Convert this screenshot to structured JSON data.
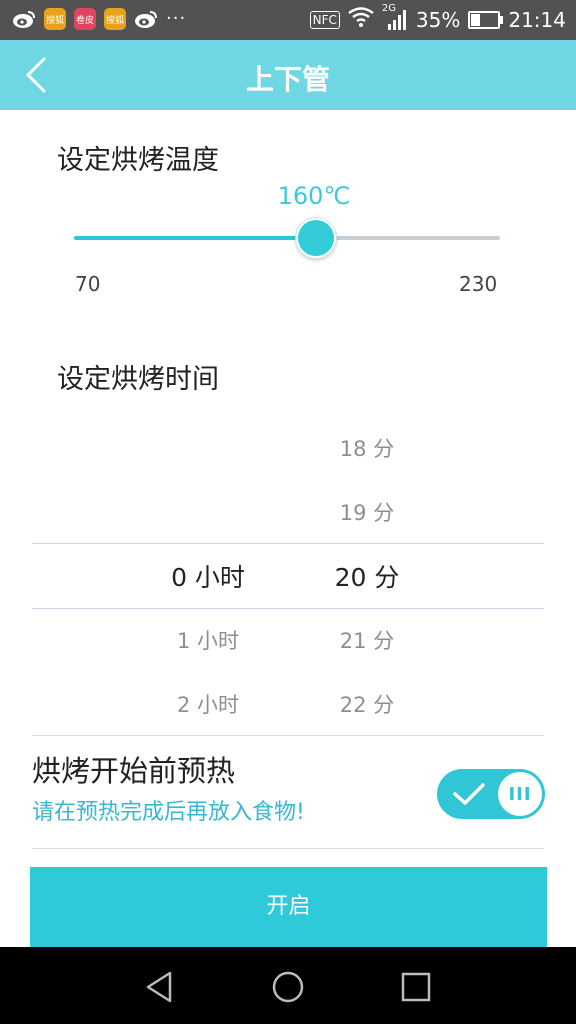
{
  "status_bar": {
    "notification_icons": [
      "weibo-icon",
      "sougou-icon",
      "juanpi-icon",
      "sougou-icon",
      "weibo-icon",
      "more-dots-icon"
    ],
    "app_badges": [
      "搜狐",
      "卷皮",
      "搜狐"
    ],
    "overflow": "···",
    "nfc": "NFC",
    "network": "2G",
    "battery": "35%",
    "battery_level": 0.35,
    "time": "21:14"
  },
  "header": {
    "title": "上下管",
    "back_icon": "chevron-left-icon"
  },
  "temperature": {
    "section_title": "设定烘烤温度",
    "value_label": "160℃",
    "value": 160,
    "min": 70,
    "max": 230,
    "min_label": "70",
    "max_label": "230"
  },
  "time": {
    "section_title": "设定烘烤时间",
    "hours_column": [
      "0 小时",
      "1 小时",
      "2 小时"
    ],
    "minutes_column": [
      "18 分",
      "19 分",
      "20 分",
      "21 分",
      "22 分"
    ],
    "selected_hours": "0 小时",
    "selected_minutes": "20 分"
  },
  "preheat": {
    "title": "烘烤开始前预热",
    "note": "请在预热完成后再放入食物!",
    "enabled": true,
    "toggle_knob": "III"
  },
  "actions": {
    "start_label": "开启"
  },
  "nav_bar": {
    "icons": [
      "back-triangle-icon",
      "home-circle-icon",
      "recents-square-icon"
    ]
  },
  "colors": {
    "accent": "#2fcad9",
    "header_bg": "#6fd7e3",
    "statusbar_bg": "#525252"
  }
}
